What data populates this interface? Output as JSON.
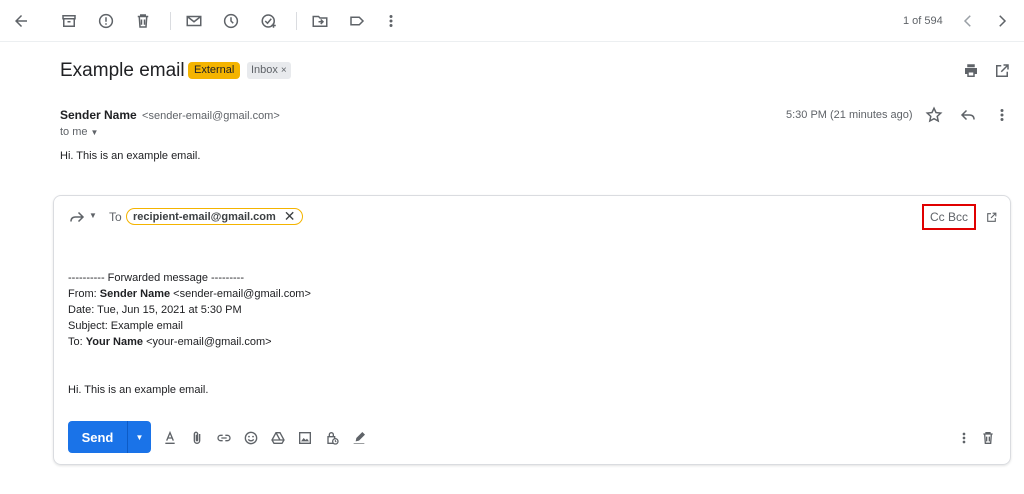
{
  "toolbar": {
    "pager": "1 of 594",
    "icons": [
      "back-arrow-icon",
      "archive-icon",
      "report-spam-icon",
      "delete-icon",
      "mark-unread-icon",
      "snooze-icon",
      "add-to-tasks-icon",
      "move-to-icon",
      "label-icon",
      "more-vert-icon",
      "chevron-left-icon",
      "chevron-right-icon",
      "print-icon",
      "open-new-window-icon"
    ]
  },
  "email": {
    "subject": "Example email",
    "badge_external": "External",
    "badge_inbox": "Inbox",
    "badge_inbox_close": "×",
    "sender_name": "Sender Name",
    "sender_email": "<sender-email@gmail.com>",
    "to_me": "to me",
    "timestamp": "5:30 PM (21 minutes ago)",
    "body": "Hi. This is an example email."
  },
  "compose": {
    "to_label": "To",
    "recipient": "recipient-email@gmail.com",
    "recipient_remove": "✕",
    "cc_bcc": "Cc Bcc",
    "forward_header": "---------- Forwarded message ---------",
    "from_label": "From:",
    "from_name": "Sender Name",
    "from_email": "<sender-email@gmail.com>",
    "date_line": "Date: Tue, Jun 15, 2021 at 5:30 PM",
    "subject_line": "Subject: Example email",
    "to_line_label": "To:",
    "to_line_name": "Your Name",
    "to_line_email": "<your-email@gmail.com>",
    "body": "Hi. This is an example email.",
    "send_label": "Send",
    "highlight_color": "#e00000",
    "accent_color": "#1a73e8"
  }
}
